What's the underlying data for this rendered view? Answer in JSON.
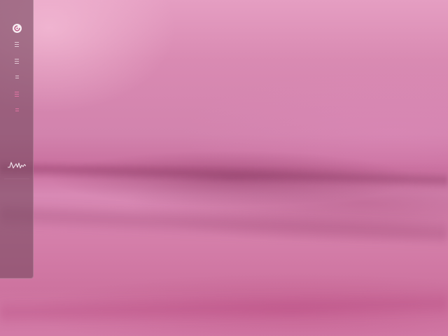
{
  "desktop": {
    "wallpaper": {
      "colors": [
        "#e59ec2",
        "#d283ad",
        "#c96f9e",
        "#d889b4"
      ]
    }
  },
  "dock": {
    "background": "#784860",
    "items": [
      {
        "id": "app-launcher",
        "icon": "app-launcher-icon"
      },
      {
        "id": "task-1",
        "icon": "window-icon"
      },
      {
        "id": "task-2",
        "icon": "window-icon"
      },
      {
        "id": "task-3",
        "icon": "window-icon"
      },
      {
        "id": "task-4",
        "icon": "window-icon",
        "accent": "#f078aa"
      },
      {
        "id": "task-5",
        "icon": "window-icon",
        "accent": "#f078aa"
      }
    ],
    "widget": {
      "icon": "activity-graph-icon"
    }
  }
}
